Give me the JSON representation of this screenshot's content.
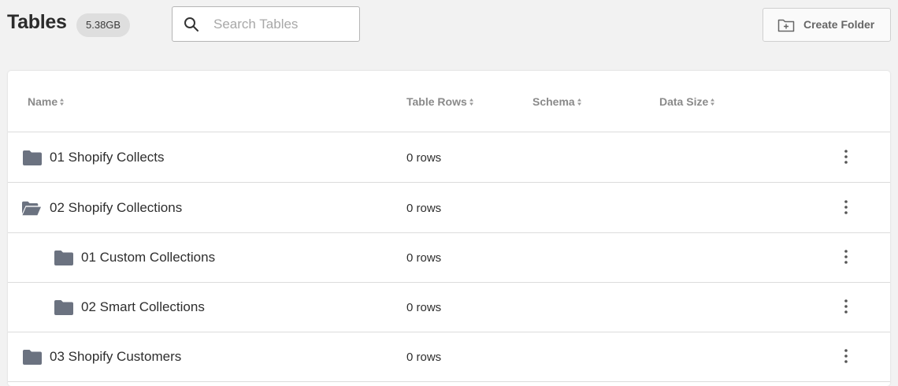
{
  "header": {
    "title": "Tables",
    "storage_badge": "5.38GB",
    "search": {
      "placeholder": "Search Tables",
      "value": ""
    },
    "create_folder_label": "Create Folder"
  },
  "table": {
    "columns": [
      {
        "label": "Name",
        "sortable": true
      },
      {
        "label": "Table Rows",
        "sortable": true
      },
      {
        "label": "Schema",
        "sortable": true
      },
      {
        "label": "Data Size",
        "sortable": true
      }
    ],
    "rows": [
      {
        "name": "01 Shopify Collects",
        "rows": "0 rows",
        "level": 0,
        "icon": "folder-icon",
        "expanded": false
      },
      {
        "name": "02 Shopify Collections",
        "rows": "0 rows",
        "level": 0,
        "icon": "folder-open-icon",
        "expanded": true
      },
      {
        "name": "01 Custom Collections",
        "rows": "0 rows",
        "level": 1,
        "icon": "folder-icon",
        "expanded": false
      },
      {
        "name": "02 Smart Collections",
        "rows": "0 rows",
        "level": 1,
        "icon": "folder-icon",
        "expanded": false
      },
      {
        "name": "03 Shopify Customers",
        "rows": "0 rows",
        "level": 0,
        "icon": "folder-icon",
        "expanded": false
      }
    ]
  },
  "colors": {
    "background": "#f2f2f2",
    "card": "#ffffff",
    "folder_icon": "#6b7280",
    "header_text": "#8a8a8a",
    "badge_bg": "#dedede"
  }
}
